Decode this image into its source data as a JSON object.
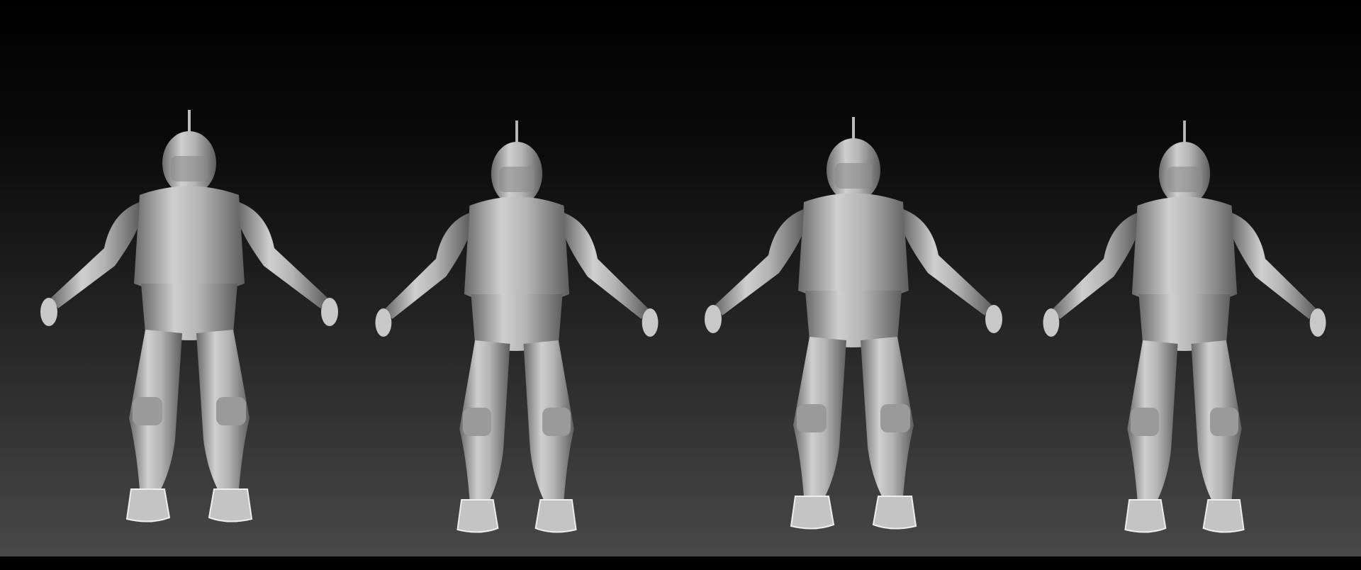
{
  "scene": {
    "colors": {
      "background_top": "#000000",
      "background_bottom": "#484848",
      "suit_light": "#d8d8d8",
      "suit_dark": "#6a6a6a"
    }
  }
}
